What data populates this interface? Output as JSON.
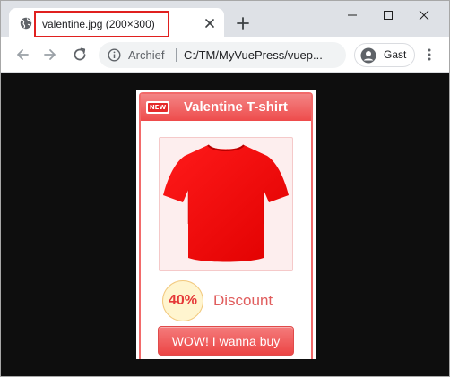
{
  "tab": {
    "title": "valentine.jpg (200×300)"
  },
  "toolbar": {
    "origin_label": "Archief",
    "url": "C:/TM/MyVuePress/vuep..."
  },
  "profile": {
    "name": "Gast"
  },
  "image_content": {
    "badge": "NEW",
    "title": "Valentine T-shirt",
    "discount_percent": "40%",
    "discount_label": "Discount",
    "buy_button_label": "WOW! I wanna buy"
  },
  "colors": {
    "accent_red": "#ee4b4b",
    "shirt_red": "#ff0000",
    "highlight_border": "#e0201f",
    "viewport_bg": "#0e0e0e"
  },
  "icons": [
    "globe-icon",
    "close-icon",
    "plus-icon",
    "minimize-icon",
    "maximize-icon",
    "window-close-icon",
    "back-arrow-icon",
    "forward-arrow-icon",
    "reload-icon",
    "info-icon",
    "avatar-icon",
    "kebab-menu-icon",
    "tshirt-icon"
  ]
}
